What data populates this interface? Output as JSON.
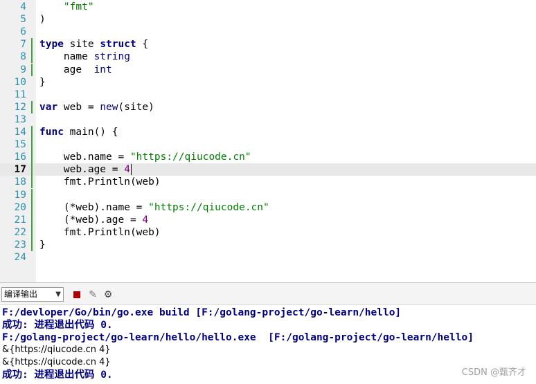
{
  "editor": {
    "current_line": "17",
    "lines": [
      {
        "n": "4",
        "text": "    \"fmt\""
      },
      {
        "n": "5",
        "text": ")"
      },
      {
        "n": "6",
        "text": ""
      },
      {
        "n": "7",
        "text": "type site struct {"
      },
      {
        "n": "8",
        "text": "    name string"
      },
      {
        "n": "9",
        "text": "    age  int"
      },
      {
        "n": "10",
        "text": "}"
      },
      {
        "n": "11",
        "text": ""
      },
      {
        "n": "12",
        "text": "var web = new(site)"
      },
      {
        "n": "13",
        "text": ""
      },
      {
        "n": "14",
        "text": "func main() {"
      },
      {
        "n": "15",
        "text": ""
      },
      {
        "n": "16",
        "text": "    web.name = \"https://qiucode.cn\""
      },
      {
        "n": "17",
        "text": "    web.age = 4"
      },
      {
        "n": "18",
        "text": "    fmt.Println(web)"
      },
      {
        "n": "19",
        "text": ""
      },
      {
        "n": "20",
        "text": "    (*web).name = \"https://qiucode.cn\""
      },
      {
        "n": "21",
        "text": "    (*web).age = 4"
      },
      {
        "n": "22",
        "text": "    fmt.Println(web)"
      },
      {
        "n": "23",
        "text": "}"
      },
      {
        "n": "24",
        "text": ""
      }
    ]
  },
  "toolbar": {
    "output_select": "编译输出",
    "stop_icon": "stop-icon",
    "clear_icon": "clear-icon",
    "settings_icon": "gear-icon"
  },
  "console": {
    "lines": [
      {
        "text": "F:/devloper/Go/bin/go.exe build [F:/golang-project/go-learn/hello]",
        "style": "bold"
      },
      {
        "text": "成功: 进程退出代码 0.",
        "style": "bold"
      },
      {
        "text": "F:/golang-project/go-learn/hello/hello.exe  [F:/golang-project/go-learn/hello]",
        "style": "bold"
      },
      {
        "text": "&{https://qiucode.cn 4}",
        "style": "plain"
      },
      {
        "text": "&{https://qiucode.cn 4}",
        "style": "plain"
      },
      {
        "text": "成功: 进程退出代码 0.",
        "style": "bold"
      }
    ]
  },
  "watermark": "CSDN @甄齐才",
  "colors": {
    "keyword": "#000080",
    "string": "#008000",
    "number": "#800080",
    "line_number": "#2b91af",
    "console_text": "#000080",
    "current_line_bg": "#e8e8e8",
    "change_bar": "#3fa33f"
  }
}
